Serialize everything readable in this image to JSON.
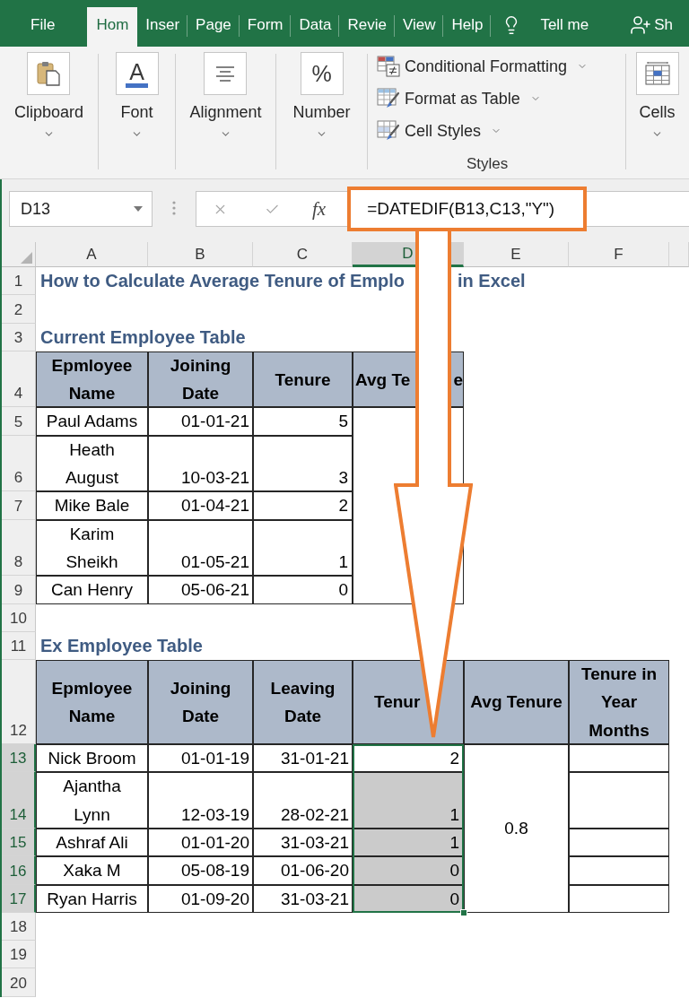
{
  "ribbon_tabs": [
    {
      "label": "File",
      "selected": false
    },
    {
      "label": "Hom",
      "selected": true
    },
    {
      "label": "Inser",
      "selected": false
    },
    {
      "label": "Page",
      "selected": false
    },
    {
      "label": "Form",
      "selected": false
    },
    {
      "label": "Data",
      "selected": false
    },
    {
      "label": "Revie",
      "selected": false
    },
    {
      "label": "View",
      "selected": false
    },
    {
      "label": "Help",
      "selected": false
    }
  ],
  "tell_me": {
    "label": "Tell me"
  },
  "share": {
    "label": "Sh"
  },
  "ribbon_groups": [
    {
      "kind": "button",
      "label": "Clipboard"
    },
    {
      "kind": "button",
      "label": "Font",
      "glyph": "A"
    },
    {
      "kind": "button",
      "label": "Alignment"
    },
    {
      "kind": "button",
      "label": "Number",
      "glyph": "%"
    },
    {
      "kind": "list",
      "label": "Styles",
      "items": [
        {
          "label": "Conditional Formatting"
        },
        {
          "label": "Format as Table"
        },
        {
          "label": "Cell Styles"
        }
      ]
    },
    {
      "kind": "button",
      "label": "Cells"
    }
  ],
  "formula_bar": {
    "name_box": "D13",
    "function_button": "fx",
    "formula": "=DATEDIF(B13,C13,\"Y\")"
  },
  "sheet": {
    "columns": [
      {
        "label": "A",
        "selected": false
      },
      {
        "label": "B",
        "selected": false
      },
      {
        "label": "C",
        "selected": false
      },
      {
        "label": "D",
        "selected": true
      },
      {
        "label": "E",
        "selected": false
      },
      {
        "label": "F",
        "selected": false
      }
    ],
    "row_numbers": [
      {
        "label": "1",
        "selected": false
      },
      {
        "label": "2",
        "selected": false
      },
      {
        "label": "3",
        "selected": false
      },
      {
        "label": "4",
        "selected": false
      },
      {
        "label": "5",
        "selected": false
      },
      {
        "label": "6",
        "selected": false
      },
      {
        "label": "7",
        "selected": false
      },
      {
        "label": "8",
        "selected": false
      },
      {
        "label": "9",
        "selected": false
      },
      {
        "label": "10",
        "selected": false
      },
      {
        "label": "11",
        "selected": false
      },
      {
        "label": "12",
        "selected": false
      },
      {
        "label": "13",
        "selected": true
      },
      {
        "label": "14",
        "selected": true
      },
      {
        "label": "15",
        "selected": true
      },
      {
        "label": "16",
        "selected": true
      },
      {
        "label": "17",
        "selected": true
      },
      {
        "label": "18",
        "selected": false
      },
      {
        "label": "19",
        "selected": false
      },
      {
        "label": "20",
        "selected": false
      }
    ],
    "title": [
      "How to Calculate Average Tenure of Emplo",
      "in Excel"
    ],
    "tables": [
      {
        "caption": "Current Employee Table",
        "headers": [
          {
            "kind": "full",
            "text": "Epmloyee Name"
          },
          {
            "kind": "full",
            "text": "Joining Date"
          },
          {
            "kind": "full",
            "text": "Tenure"
          },
          {
            "kind": "cut",
            "parts": [
              "Avg Te",
              "e"
            ]
          }
        ],
        "rows": [
          {
            "name": "Paul Adams",
            "dates": [
              "01-01-21"
            ],
            "tenure": "5",
            "selected": false,
            "active": false
          },
          {
            "name": "Heath August",
            "dates": [
              "10-03-21"
            ],
            "tenure": "3",
            "selected": false,
            "active": false
          },
          {
            "name": "Mike Bale",
            "dates": [
              "01-04-21"
            ],
            "tenure": "2",
            "selected": false,
            "active": false
          },
          {
            "name": "Karim Sheikh",
            "dates": [
              "01-05-21"
            ],
            "tenure": "1",
            "selected": false,
            "active": false
          },
          {
            "name": "Can Henry",
            "dates": [
              "05-06-21"
            ],
            "tenure": "0",
            "selected": false,
            "active": false
          }
        ]
      },
      {
        "caption": "Ex Employee Table",
        "headers": [
          {
            "kind": "full",
            "text": "Epmloyee Name"
          },
          {
            "kind": "full",
            "text": "Joining Date"
          },
          {
            "kind": "full",
            "text": "Leaving Date"
          },
          {
            "kind": "cut",
            "parts": [
              "Tenur"
            ]
          },
          {
            "kind": "full",
            "text": "Avg Tenure"
          },
          {
            "kind": "full",
            "text": "Tenure in Year Months"
          }
        ],
        "average": "0.8",
        "rows": [
          {
            "name": "Nick Broom",
            "dates": [
              "01-01-19",
              "31-01-21"
            ],
            "tenure": "2",
            "selected": true,
            "active": true
          },
          {
            "name": "Ajantha Lynn",
            "dates": [
              "12-03-19",
              "28-02-21"
            ],
            "tenure": "1",
            "selected": true,
            "active": false
          },
          {
            "name": "Ashraf Ali",
            "dates": [
              "01-01-20",
              "31-03-21"
            ],
            "tenure": "1",
            "selected": true,
            "active": false
          },
          {
            "name": "Xaka M",
            "dates": [
              "05-08-19",
              "01-06-20"
            ],
            "tenure": "0",
            "selected": true,
            "active": false
          },
          {
            "name": "Ryan Harris",
            "dates": [
              "01-09-20",
              "31-03-21"
            ],
            "tenure": "0",
            "selected": true,
            "active": false
          }
        ]
      }
    ]
  }
}
